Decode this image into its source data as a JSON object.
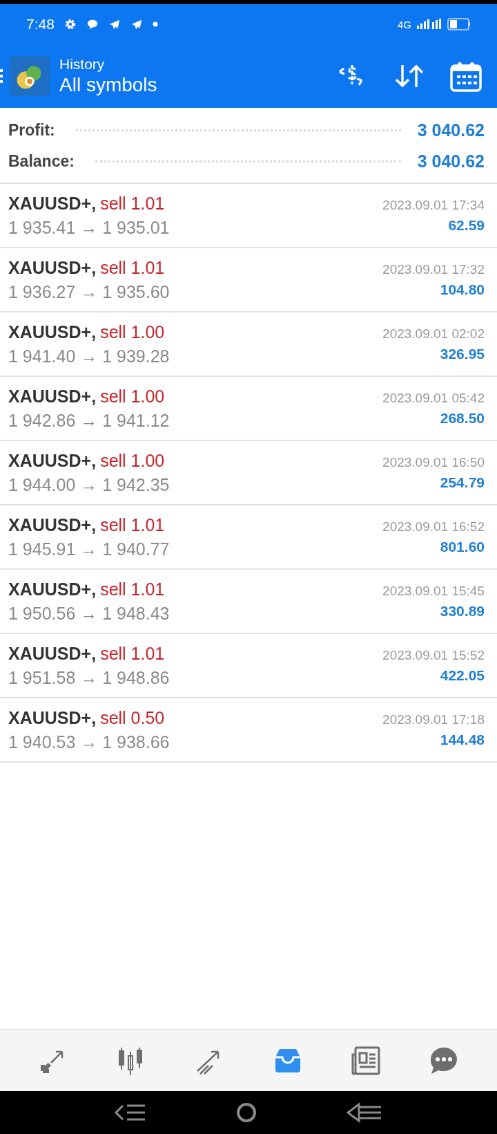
{
  "status_bar": {
    "time": "7:48",
    "network": "4G"
  },
  "header": {
    "subtitle": "History",
    "title": "All symbols"
  },
  "summary": [
    {
      "label": "Profit:",
      "value": "3 040.62"
    },
    {
      "label": "Balance:",
      "value": "3 040.62"
    }
  ],
  "deals": [
    {
      "symbol": "XAUUSD+,",
      "kind": "sell",
      "deal": "sell 1.01",
      "prices": "1 935.41 → 1 935.01",
      "time": "2023.09.01 17:34",
      "profit": "62.59"
    },
    {
      "symbol": "XAUUSD+,",
      "kind": "sell",
      "deal": "sell 1.01",
      "prices": "1 936.27 → 1 935.60",
      "time": "2023.09.01 17:32",
      "profit": "104.80"
    },
    {
      "symbol": "XAUUSD+,",
      "kind": "sell",
      "deal": "sell 1.00",
      "prices": "1 941.40 → 1 939.28",
      "time": "2023.09.01 02:02",
      "profit": "326.95"
    },
    {
      "symbol": "XAUUSD+,",
      "kind": "sell",
      "deal": "sell 1.00",
      "prices": "1 942.86 → 1 941.12",
      "time": "2023.09.01 05:42",
      "profit": "268.50"
    },
    {
      "symbol": "XAUUSD+,",
      "kind": "sell",
      "deal": "sell 1.00",
      "prices": "1 944.00 → 1 942.35",
      "time": "2023.09.01 16:50",
      "profit": "254.79"
    },
    {
      "symbol": "XAUUSD+,",
      "kind": "sell",
      "deal": "sell 1.01",
      "prices": "1 945.91 → 1 940.77",
      "time": "2023.09.01 16:52",
      "profit": "801.60"
    },
    {
      "symbol": "XAUUSD+,",
      "kind": "sell",
      "deal": "sell 1.01",
      "prices": "1 950.56 → 1 948.43",
      "time": "2023.09.01 15:45",
      "profit": "330.89"
    },
    {
      "symbol": "XAUUSD+,",
      "kind": "sell",
      "deal": "sell 1.01",
      "prices": "1 951.58 → 1 948.86",
      "time": "2023.09.01 15:52",
      "profit": "422.05"
    },
    {
      "symbol": "XAUUSD+,",
      "kind": "sell",
      "deal": "sell 0.50",
      "prices": "1 940.53 → 1 938.66",
      "time": "2023.09.01 17:18",
      "profit": "144.48"
    }
  ],
  "tabs": [
    {
      "kind": "quotes",
      "selected": false
    },
    {
      "kind": "chart",
      "selected": false
    },
    {
      "kind": "trade",
      "selected": false
    },
    {
      "kind": "history",
      "selected": true
    },
    {
      "kind": "news",
      "selected": false
    },
    {
      "kind": "chat",
      "selected": false
    }
  ]
}
